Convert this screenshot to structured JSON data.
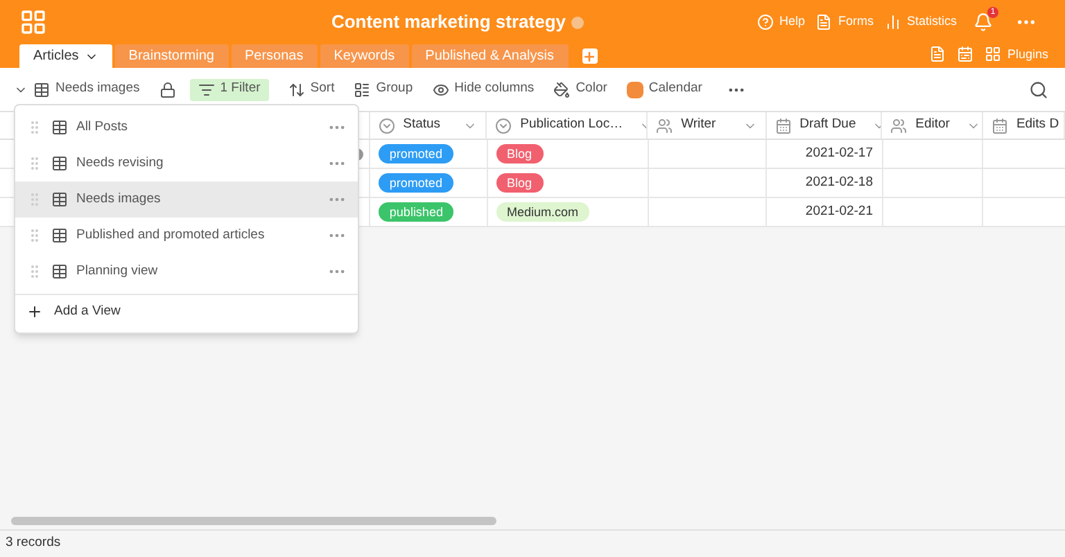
{
  "header": {
    "title": "Content marketing strategy",
    "actions": [
      {
        "kind": "help",
        "label": "Help"
      },
      {
        "kind": "forms",
        "label": "Forms"
      },
      {
        "kind": "statistics",
        "label": "Statistics"
      }
    ],
    "notification_count": "1"
  },
  "tabs": [
    {
      "label": "Articles",
      "selected": true
    },
    {
      "label": "Brainstorming",
      "selected": false
    },
    {
      "label": "Personas",
      "selected": false
    },
    {
      "label": "Keywords",
      "selected": false
    },
    {
      "label": "Published & Analysis",
      "selected": false
    }
  ],
  "plugins_label": "Plugins",
  "toolbar": {
    "view": "Needs images",
    "filter": "1 Filter",
    "items": [
      {
        "kind": "sort",
        "label": "Sort"
      },
      {
        "kind": "group",
        "label": "Group"
      },
      {
        "kind": "hide",
        "label": "Hide columns"
      },
      {
        "kind": "color",
        "label": "Color"
      },
      {
        "kind": "calendar",
        "label": "Calendar"
      }
    ]
  },
  "views_menu": {
    "items": [
      {
        "label": "All Posts",
        "selected": false
      },
      {
        "label": "Needs revising",
        "selected": false
      },
      {
        "label": "Needs images",
        "selected": true
      },
      {
        "label": "Published and promoted articles",
        "selected": false
      },
      {
        "label": "Planning view",
        "selected": false
      }
    ],
    "add_label": "Add a View"
  },
  "table": {
    "columns": [
      {
        "kind": "select",
        "label": "Status"
      },
      {
        "kind": "select",
        "label": "Publication Loc…"
      },
      {
        "kind": "person",
        "label": "Writer"
      },
      {
        "kind": "date",
        "label": "Draft Due"
      },
      {
        "kind": "person",
        "label": "Editor"
      },
      {
        "kind": "date",
        "label": "Edits D"
      }
    ],
    "rows": [
      {
        "status": {
          "text": "promoted",
          "color": "#2d9cf5"
        },
        "publication": {
          "text": "Blog",
          "color": "#f1606e"
        },
        "draft_due": "2021-02-17"
      },
      {
        "status": {
          "text": "promoted",
          "color": "#2d9cf5"
        },
        "publication": {
          "text": "Blog",
          "color": "#f1606e"
        },
        "draft_due": "2021-02-18"
      },
      {
        "status": {
          "text": "published",
          "color": "#3bc46a"
        },
        "publication": {
          "text": "Medium.com",
          "color": "#def5cf"
        },
        "draft_due": "2021-02-21"
      }
    ]
  },
  "status_bar": "3 records"
}
